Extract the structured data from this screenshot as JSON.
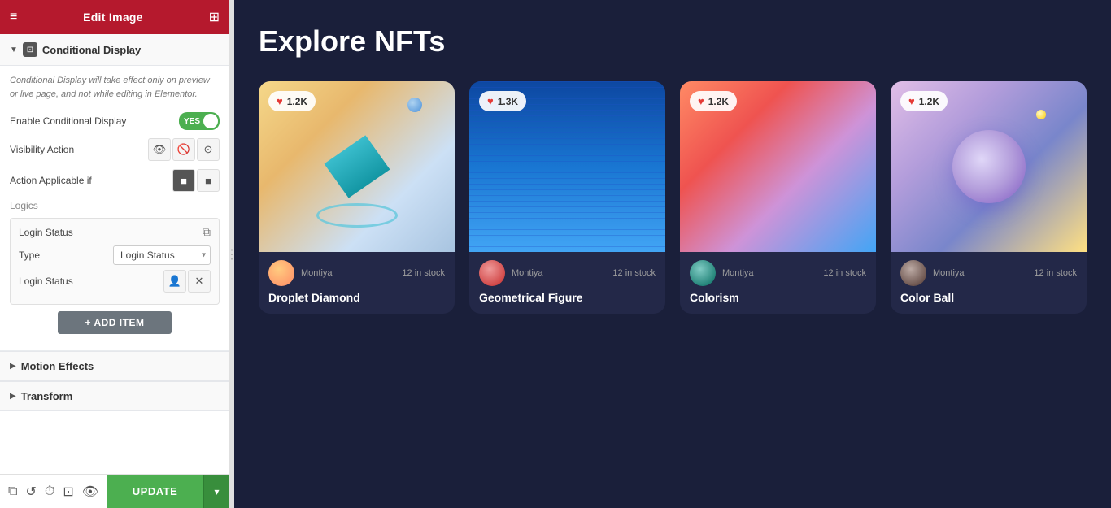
{
  "header": {
    "title": "Edit Image",
    "menu_icon": "≡",
    "grid_icon": "⊞"
  },
  "conditional_display": {
    "section_title": "Conditional Display",
    "info_text": "Conditional Display will take effect only on preview or live page, and not while editing in Elementor.",
    "enable_label": "Enable Conditional Display",
    "toggle_label": "YES",
    "visibility_action_label": "Visibility Action",
    "action_applicable_label": "Action Applicable if",
    "logics_label": "Logics",
    "login_status_label": "Login Status",
    "type_label": "Type",
    "type_value": "Login Status",
    "login_status_row_label": "Login Status",
    "add_item_label": "+ ADD ITEM"
  },
  "motion_effects": {
    "section_title": "Motion Effects"
  },
  "transform": {
    "section_title": "Transform"
  },
  "bottom_bar": {
    "update_label": "UPDATE"
  },
  "main": {
    "title": "Explore NFTs",
    "cards": [
      {
        "title": "Droplet Diamond",
        "username": "Montiya",
        "stock": "12 in stock",
        "likes": "1.2K"
      },
      {
        "title": "Geometrical Figure",
        "username": "Montiya",
        "stock": "12 in stock",
        "likes": "1.3K"
      },
      {
        "title": "Colorism",
        "username": "Montiya",
        "stock": "12 in stock",
        "likes": "1.2K"
      },
      {
        "title": "Color Ball",
        "username": "Montiya",
        "stock": "12 in stock",
        "likes": "1.2K"
      }
    ]
  }
}
